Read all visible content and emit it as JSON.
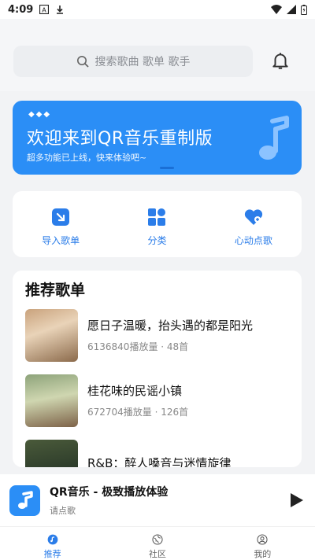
{
  "status_bar": {
    "time": "4:09"
  },
  "search": {
    "placeholder": "搜索歌曲 歌单 歌手"
  },
  "banner": {
    "title": "欢迎来到QR音乐重制版",
    "subtitle": "超多功能已上线，快来体验吧~",
    "color": "#2b8ef6"
  },
  "quick_actions": [
    {
      "label": "导入歌单",
      "icon": "import-icon"
    },
    {
      "label": "分类",
      "icon": "category-icon"
    },
    {
      "label": "心动点歌",
      "icon": "heart-icon"
    }
  ],
  "recommended": {
    "title": "推荐歌单",
    "items": [
      {
        "name": "愿日子温暖，抬头遇的都是阳光",
        "meta": "6136840播放量 · 48首"
      },
      {
        "name": "桂花味的民谣小镇",
        "meta": "672704播放量 · 126首"
      },
      {
        "name": "R&B：醉人嗓音与迷情旋律",
        "meta": ""
      }
    ]
  },
  "player": {
    "title": "QR音乐 - 极致播放体验",
    "subtitle": "请点歌"
  },
  "tabs": [
    {
      "label": "推荐",
      "active": true
    },
    {
      "label": "社区",
      "active": false
    },
    {
      "label": "我的",
      "active": false
    }
  ],
  "accent": "#2b7de9"
}
